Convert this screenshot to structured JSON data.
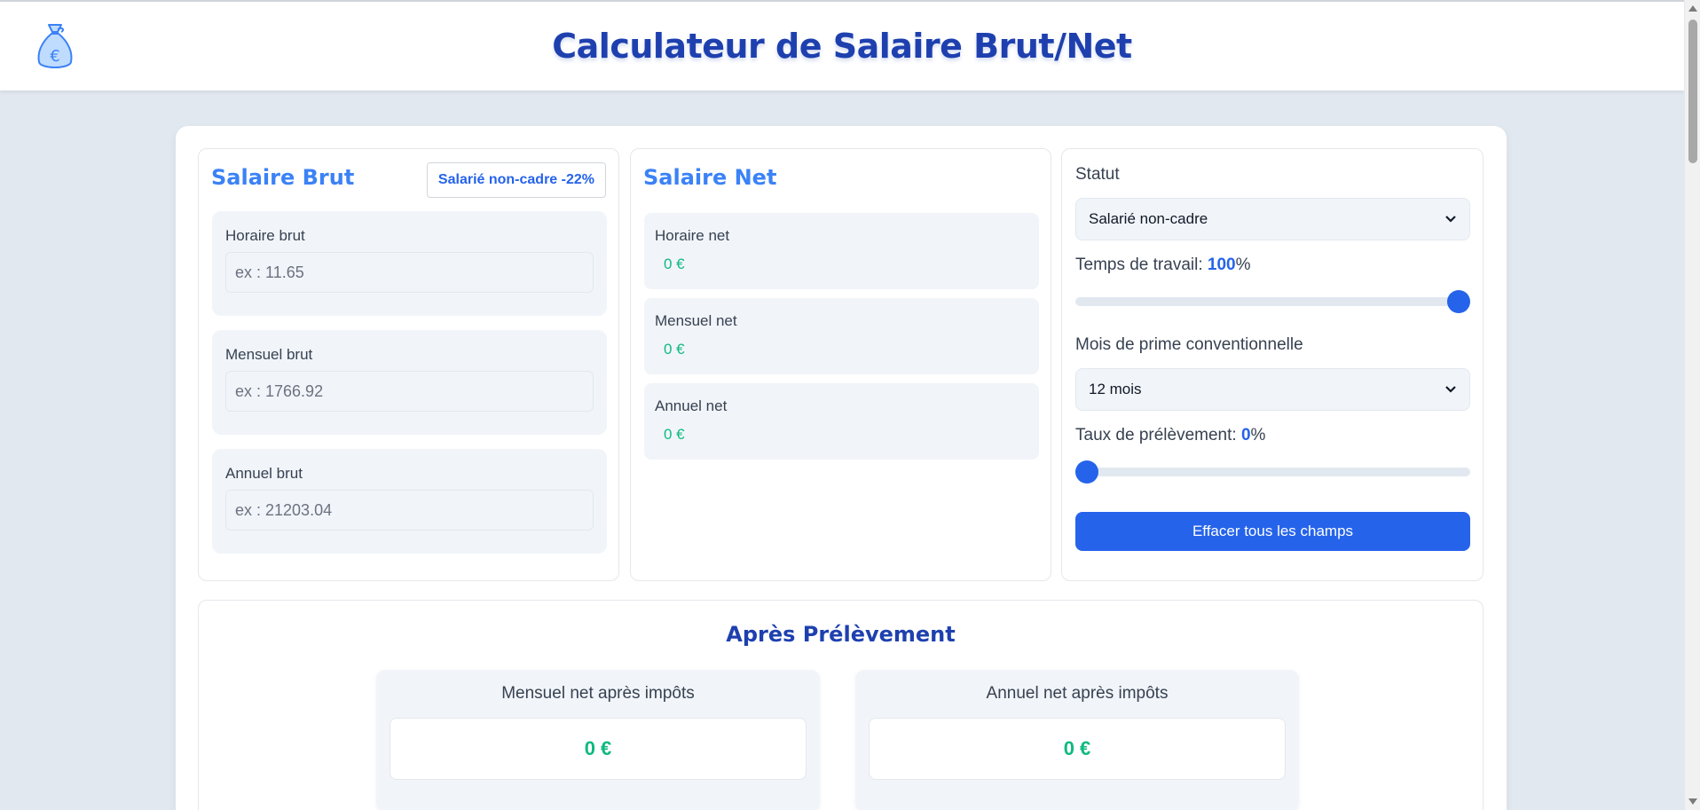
{
  "header": {
    "title": "Calculateur de Salaire Brut/Net",
    "logo_icon": "money-bag-euro-icon"
  },
  "brut": {
    "title": "Salaire Brut",
    "badge": "Salarié non-cadre -22%",
    "fields": [
      {
        "label": "Horaire brut",
        "value": "",
        "placeholder": "ex : 11.65"
      },
      {
        "label": "Mensuel brut",
        "value": "",
        "placeholder": "ex : 1766.92"
      },
      {
        "label": "Annuel brut",
        "value": "",
        "placeholder": "ex : 21203.04"
      }
    ]
  },
  "net": {
    "title": "Salaire Net",
    "items": [
      {
        "label": "Horaire net",
        "value": "0 €"
      },
      {
        "label": "Mensuel net",
        "value": "0 €"
      },
      {
        "label": "Annuel net",
        "value": "0 €"
      }
    ]
  },
  "settings": {
    "status_label": "Statut",
    "status_value": "Salarié non-cadre",
    "work_time_label": "Temps de travail: ",
    "work_time_value": "100",
    "work_time_unit": "%",
    "work_time_fraction": 1.0,
    "bonus_label": "Mois de prime conventionnelle",
    "bonus_value": "12 mois",
    "tax_label": "Taux de prélèvement: ",
    "tax_value": "0",
    "tax_unit": "%",
    "tax_fraction": 0.0,
    "clear_button": "Effacer tous les champs"
  },
  "after": {
    "title": "Après Prélèvement",
    "monthly_label": "Mensuel net après impôts",
    "monthly_value": "0 €",
    "annual_label": "Annuel net après impôts",
    "annual_value": "0 €"
  },
  "colors": {
    "accent": "#2563eb",
    "title": "#1e40af",
    "positive": "#10b981",
    "background": "#e2e8f0"
  }
}
